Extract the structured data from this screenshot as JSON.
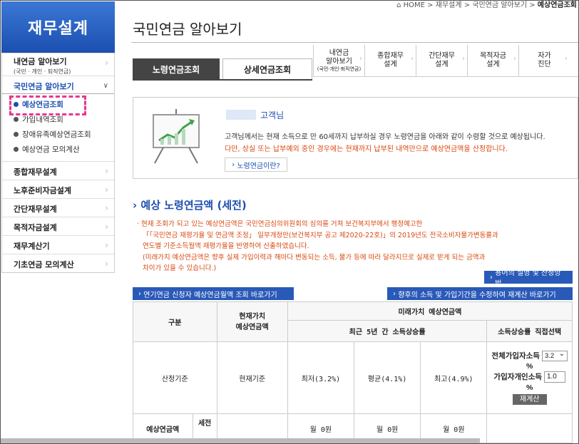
{
  "sidebar": {
    "title": "재무설계",
    "items": [
      {
        "label": "내연금 알아보기",
        "sub": "(국민 · 개인 · 퇴직연금)"
      },
      {
        "label": "국민연금 알아보기"
      },
      {
        "label": "종합재무설계"
      },
      {
        "label": "노후준비자금설계"
      },
      {
        "label": "간단재무설계"
      },
      {
        "label": "목적자금설계"
      },
      {
        "label": "재무계산기"
      },
      {
        "label": "기초연금 모의계산"
      }
    ],
    "sub_items": [
      "예상연금조회",
      "가입내역조회",
      "장애유족예상연금조회",
      "예상연금 모의계산"
    ]
  },
  "breadcrumb": {
    "home": "HOME",
    "level1": "재무설계",
    "level2": "국민연금 알아보기",
    "current": "예상연금조회"
  },
  "page_title": "국민연금 알아보기",
  "tabs": [
    "노령연금조회",
    "상세연금조회"
  ],
  "quick_links": [
    {
      "line1": "내연금",
      "line2": "알아보기",
      "small": "(국민·개인·퇴직연금)"
    },
    {
      "line1": "종합재무",
      "line2": "설계"
    },
    {
      "line1": "간단재무",
      "line2": "설계"
    },
    {
      "line1": "목적자금",
      "line2": "설계"
    },
    {
      "line1": "자가",
      "line2": "진단"
    }
  ],
  "info": {
    "customer_suffix": "고객님",
    "text1": "고객님께서는 현재 소득으로 만 60세까지 납부하실 경우 노령연금을 아래와 같이 수령할 것으로 예상됩니다.",
    "text2": "다만, 상실 또는 납부예외 중인 경우에는 현재까지 납부된 내역만으로 예상연금액을 산정합니다.",
    "button": "노령연금이란?"
  },
  "section_title": "예상 노령연금액 (세전)",
  "notice": [
    "· 현재 조회가 되고 있는 예상연금액은 국민연금심의위원회의 심의를 거쳐 보건복지부에서 행정예고한",
    "「「국민연금 재평가율 및 연금액 조정」 일부개정안(보건복지부 공고 제2020-22호)」의 2019년도 전국소비자물가변동률과",
    "연도별 기준소득월액 재평가율을 반영하여 산출하였습니다.",
    "(미래가치 예상연금액은 향후 실제 가입이력과 해마다 변동되는 소득, 물가 등에 따라 달라지므로 실제로 받게 되는 금액과",
    "차이가 있을 수 있습니다.)"
  ],
  "buttons": {
    "terms": "용어의 설명 및 산정방법",
    "deferred": "연기연금 신청자 예상연금월액 조회 바로가기",
    "recalc_link": "향후의 소득 및 가입기간을 수정하여 재계산 바로가기"
  },
  "table": {
    "col_category": "구분",
    "col_current": "현재가치\n예상연금액",
    "col_future": "미래가치 예상연금액",
    "col_recent": "최근 5년 간 소득상승률",
    "col_direct": "소득상승률 직접선택",
    "row_basis": "산정기준",
    "current_basis": "현재기준",
    "min": "최저(3.2%)",
    "avg": "평균(4.1%)",
    "max": "최고(4.9%)",
    "all_income_label": "전체가입자소득",
    "all_income_value": "3.2",
    "percent": "%",
    "personal_income_label": "가입자개인소득",
    "personal_income_value": "1.0",
    "recalc": "재계산",
    "row_expected": "예상연금액",
    "pretax": "세전",
    "val_min": "월 0원",
    "val_avg": "월 0원",
    "val_max": "월 0원"
  }
}
